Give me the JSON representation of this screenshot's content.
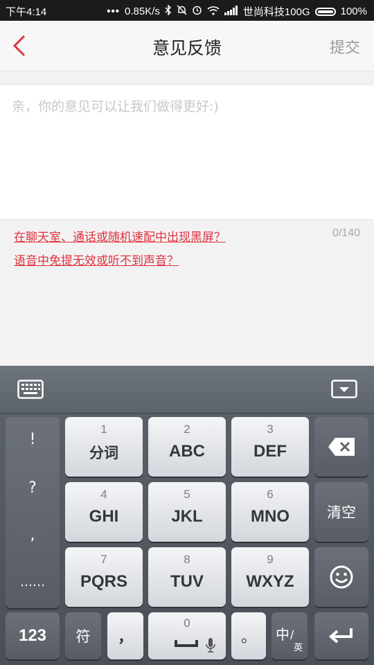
{
  "status_bar": {
    "time": "下午4:14",
    "speed": "0.85K/s",
    "carrier": "世尚科技100G",
    "battery": "100%"
  },
  "header": {
    "title": "意见反馈",
    "submit_label": "提交"
  },
  "feedback": {
    "placeholder": "亲，你的意见可以让我们做得更好:)",
    "value": "",
    "counter": "0/140"
  },
  "suggestions": [
    "在聊天室、通话或随机速配中出现黑屏？",
    "语音中免提无效或听不到声音？"
  ],
  "keyboard": {
    "punct_column": [
      "!",
      "?",
      ",",
      "……"
    ],
    "keys": [
      {
        "num": "1",
        "label": "分词"
      },
      {
        "num": "2",
        "label": "ABC"
      },
      {
        "num": "3",
        "label": "DEF"
      },
      {
        "num": "4",
        "label": "GHI"
      },
      {
        "num": "5",
        "label": "JKL"
      },
      {
        "num": "6",
        "label": "MNO"
      },
      {
        "num": "7",
        "label": "PQRS"
      },
      {
        "num": "8",
        "label": "TUV"
      },
      {
        "num": "9",
        "label": "WXYZ"
      }
    ],
    "clear_label": "清空",
    "numbers_label": "123",
    "symbols_label": "符",
    "comma_label": "，",
    "space_num": "0",
    "period_label": "。",
    "lang_main": "中",
    "lang_sub": "英"
  }
}
